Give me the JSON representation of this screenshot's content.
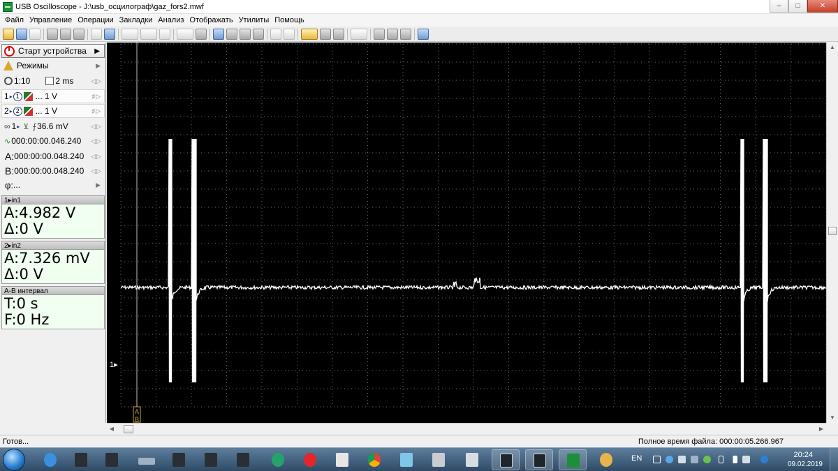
{
  "window": {
    "title": "USB Oscilloscope - J:\\usb_осцилограф\\gaz_fors2.mwf",
    "minimize": "–",
    "maximize": "□",
    "close": "✕"
  },
  "menu": [
    "Файл",
    "Управление",
    "Операции",
    "Закладки",
    "Анализ",
    "Отображать",
    "Утилиты",
    "Помощь"
  ],
  "left_panel": {
    "start_label": "Старт устройства",
    "modes_label": "Режимы",
    "zoom_value": "1:10",
    "timebase_value": "2 ms",
    "channels": [
      {
        "num": "1",
        "circle": "1",
        "value": "... 1 V"
      },
      {
        "num": "2",
        "circle": "2",
        "value": "... 1 V"
      }
    ],
    "trigger": {
      "channel": "1",
      "level": "36.6 mV"
    },
    "trigger_time": "000:00:00.046.240",
    "cursor_a_label": "A:",
    "cursor_a_time": "000:00:00.048.240",
    "cursor_b_label": "B:",
    "cursor_b_time": "000:00:00.048.240",
    "phase_label": "φ:",
    "phase_value": "..."
  },
  "measurements": [
    {
      "header": "1▸in1",
      "lines": [
        "A:4.982 V",
        "Δ:0 V"
      ]
    },
    {
      "header": "2▸in2",
      "lines": [
        "A:7.326 mV",
        "Δ:0 V"
      ]
    },
    {
      "header": "A-B интервал",
      "lines": [
        "T:0 s",
        "F:0 Hz"
      ]
    }
  ],
  "scope": {
    "channel_marker": "1▸",
    "cursor_marker_a": "A",
    "cursor_marker_b": "B",
    "grid_color": "#6e6e6e",
    "trace_color": "#ffffff"
  },
  "status": {
    "left": "Готов...",
    "right": "Полное время файла: 000:00:05.266.967"
  },
  "taskbar": {
    "lang": "EN",
    "time": "20:24",
    "date": "09.02.2019"
  }
}
